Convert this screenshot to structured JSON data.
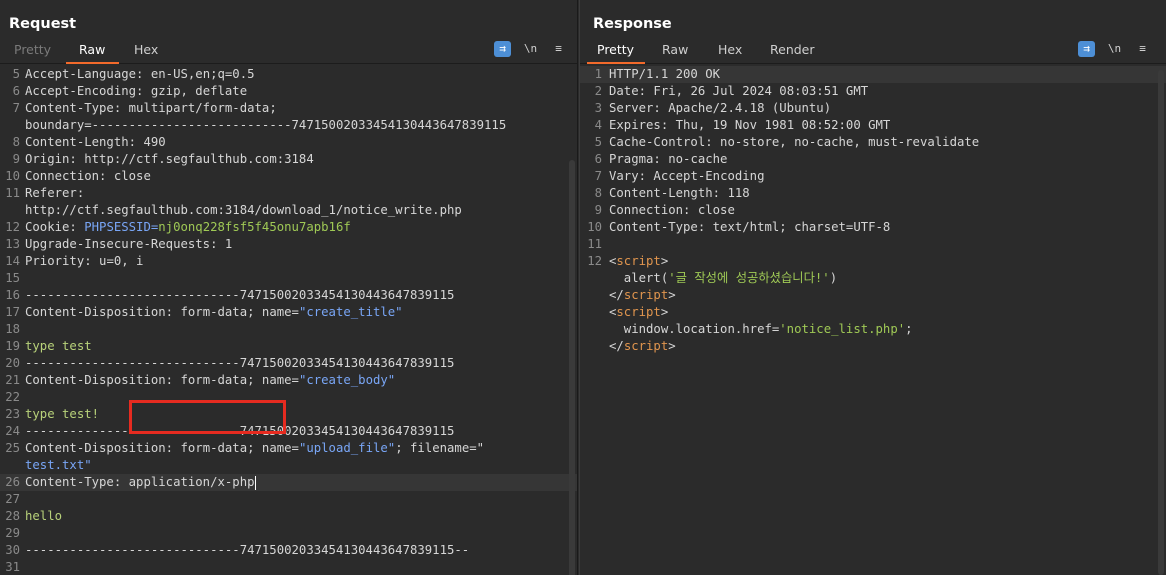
{
  "layout_switch": {
    "icons": [
      "split-horizontal-icon",
      "split-vertical-icon",
      "single-pane-icon"
    ]
  },
  "request": {
    "title": "Request",
    "tabs": [
      "Pretty",
      "Raw",
      "Hex"
    ],
    "active_tab": "Raw",
    "tools": {
      "wrap": "⇉",
      "newline": "\\n",
      "menu": "≡"
    },
    "lines": [
      {
        "n": "5",
        "key": "Accept-Language:",
        "val": " en-US,en;q=0.5"
      },
      {
        "n": "6",
        "key": "Accept-Encoding:",
        "val": " gzip, deflate"
      },
      {
        "n": "7",
        "key": "Content-Type:",
        "val": " multipart/form-data;"
      },
      {
        "n": "",
        "key": "boundary=",
        "val": "---------------------------747150020334541304436478391​15"
      },
      {
        "n": "8",
        "key": "Content-Length:",
        "val": " 490"
      },
      {
        "n": "9",
        "key": "Origin:",
        "val": " http://ctf.segfaulthub.com:3184"
      },
      {
        "n": "10",
        "key": "Connection:",
        "val": " close"
      },
      {
        "n": "11",
        "key": "Referer:",
        "val": ""
      },
      {
        "n": "",
        "key": "",
        "val": "http://ctf.segfaulthub.com:3184/download_1/notice_write.php"
      },
      {
        "n": "12",
        "key": "Cookie:",
        "val": " ",
        "cookie_name": "PHPSESSID=",
        "cookie_val": "nj0onq228fsf5f45onu7apb16f"
      },
      {
        "n": "13",
        "key": "Upgrade-Insecure-Requests:",
        "val": " 1"
      },
      {
        "n": "14",
        "key": "Priority:",
        "val": " u=0, i"
      },
      {
        "n": "15",
        "key": "",
        "val": ""
      },
      {
        "n": "16",
        "key": "",
        "val": "-----------------------------747150020334541304436478391​15"
      },
      {
        "n": "17",
        "key": "Content-Disposition:",
        "val": " form-data; name=",
        "q": "\"create_title\""
      },
      {
        "n": "18",
        "key": "",
        "val": ""
      },
      {
        "n": "19",
        "key": "",
        "val": "",
        "body": "type test"
      },
      {
        "n": "20",
        "key": "",
        "val": "-----------------------------747150020334541304436478391​15"
      },
      {
        "n": "21",
        "key": "Content-Disposition:",
        "val": " form-data; name=",
        "q": "\"create_body\""
      },
      {
        "n": "22",
        "key": "",
        "val": ""
      },
      {
        "n": "23",
        "key": "",
        "val": "",
        "body": "type test!"
      },
      {
        "n": "24",
        "key": "",
        "val": "-----------------------------747150020334541304436478391​15"
      },
      {
        "n": "25",
        "key": "Content-Disposition:",
        "val": " form-data; name=",
        "q": "\"upload_file\"",
        "tail": "; filename=\""
      },
      {
        "n": "",
        "key": "",
        "val": "",
        "q": "test.txt\""
      },
      {
        "n": "26",
        "key": "Content-Type:",
        "val": " application/x-php",
        "cursor": true,
        "hl": true
      },
      {
        "n": "27",
        "key": "",
        "val": ""
      },
      {
        "n": "28",
        "key": "",
        "val": "",
        "body": "hello"
      },
      {
        "n": "29",
        "key": "",
        "val": ""
      },
      {
        "n": "30",
        "key": "",
        "val": "-----------------------------747150020334541304436478391​15--"
      },
      {
        "n": "31",
        "key": "",
        "val": ""
      }
    ]
  },
  "response": {
    "title": "Response",
    "tabs": [
      "Pretty",
      "Raw",
      "Hex",
      "Render"
    ],
    "active_tab": "Pretty",
    "tools": {
      "wrap": "⇉",
      "newline": "\\n",
      "menu": "≡"
    },
    "lines": [
      {
        "n": "1",
        "key": "HTTP/1.1 200 OK",
        "val": "",
        "hl": true
      },
      {
        "n": "2",
        "key": "Date:",
        "val": " Fri, 26 Jul 2024 08:03:51 GMT"
      },
      {
        "n": "3",
        "key": "Server:",
        "val": " Apache/2.4.18 (Ubuntu)"
      },
      {
        "n": "4",
        "key": "Expires:",
        "val": " Thu, 19 Nov 1981 08:52:00 GMT"
      },
      {
        "n": "5",
        "key": "Cache-Control:",
        "val": " no-store, no-cache, must-revalidate"
      },
      {
        "n": "6",
        "key": "Pragma:",
        "val": " no-cache"
      },
      {
        "n": "7",
        "key": "Vary:",
        "val": " Accept-Encoding"
      },
      {
        "n": "8",
        "key": "Content-Length:",
        "val": " 118"
      },
      {
        "n": "9",
        "key": "Connection:",
        "val": " close"
      },
      {
        "n": "10",
        "key": "Content-Type:",
        "val": " text/html; charset=UTF-8"
      },
      {
        "n": "11",
        "key": "",
        "val": ""
      },
      {
        "n": "12",
        "key": "",
        "val": "",
        "t1": "<",
        "tagname": "script",
        "t2": ">"
      },
      {
        "n": "",
        "key": "",
        "val": "  alert(",
        "kor": "'글 작성에 성공하셨습니다!'",
        "after": ")"
      },
      {
        "n": "",
        "key": "",
        "val": "",
        "t1": "</",
        "tagname": "script",
        "t2": ">"
      },
      {
        "n": "",
        "key": "",
        "val": "",
        "t1": "<",
        "tagname": "script",
        "t2": ">"
      },
      {
        "n": "",
        "key": "",
        "val": "  window.location.href=",
        "kor": "'notice_list.php'",
        "after": ";"
      },
      {
        "n": "",
        "key": "",
        "val": "",
        "t1": "</",
        "tagname": "script",
        "t2": ">"
      }
    ]
  }
}
